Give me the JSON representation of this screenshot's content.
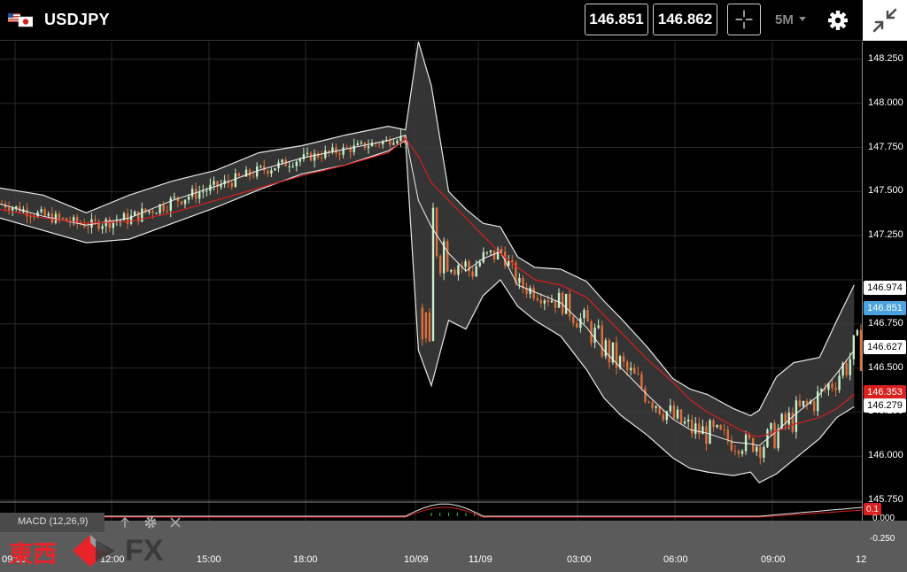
{
  "header": {
    "symbol": "USDJPY",
    "bid": "146.851",
    "ask": "146.862",
    "timeframe": "5M"
  },
  "price_axis": {
    "ticks": [
      "148.250",
      "148.000",
      "147.750",
      "147.500",
      "147.250",
      "146.750",
      "146.500",
      "146.250",
      "146.000",
      "145.750"
    ],
    "markers": {
      "upper_band": "146.974",
      "current": "146.851",
      "middle_band": "146.627",
      "ma": "146.353",
      "lower_band": "146.279"
    }
  },
  "time_axis": {
    "ticks": [
      "09:00",
      "12:00",
      "15:00",
      "18:00",
      "10/09",
      "11/09",
      "03:00",
      "06:00",
      "09:00",
      "12"
    ]
  },
  "macd": {
    "title": "MACD (12,26,9)",
    "current_value": "0.1",
    "ticks": [
      "0.000",
      "-0.250"
    ]
  },
  "logo": {
    "kanji": "東西",
    "suffix": "FX"
  },
  "colors": {
    "background": "#000000",
    "bull": "#c8f0c8",
    "bear": "#e0703a",
    "band_fill": "#3a3a3a",
    "ma": "#d8201f",
    "accent_blue": "#4aa3df"
  },
  "chart_data": {
    "type": "candlestick",
    "symbol": "USDJPY",
    "timeframe": "5M",
    "ylim": [
      145.75,
      148.35
    ],
    "bollinger": {
      "x_frac": [
        0.0,
        0.05,
        0.1,
        0.15,
        0.2,
        0.25,
        0.3,
        0.35,
        0.4,
        0.45,
        0.47,
        0.485,
        0.5,
        0.52,
        0.54,
        0.56,
        0.58,
        0.6,
        0.62,
        0.65,
        0.68,
        0.7,
        0.72,
        0.75,
        0.78,
        0.8,
        0.82,
        0.85,
        0.87,
        0.88,
        0.9,
        0.92,
        0.95,
        0.97,
        0.99
      ],
      "upper": [
        147.52,
        147.48,
        147.38,
        147.48,
        147.56,
        147.62,
        147.72,
        147.76,
        147.82,
        147.87,
        147.85,
        148.35,
        148.1,
        147.5,
        147.4,
        147.32,
        147.3,
        147.13,
        147.07,
        147.06,
        146.99,
        146.88,
        146.78,
        146.62,
        146.44,
        146.38,
        146.35,
        146.27,
        146.23,
        146.26,
        146.45,
        146.53,
        146.56,
        146.77,
        146.97
      ],
      "middle": [
        147.43,
        147.36,
        147.31,
        147.35,
        147.45,
        147.53,
        147.62,
        147.69,
        147.74,
        147.79,
        147.82,
        147.45,
        147.3,
        147.15,
        147.05,
        147.12,
        147.16,
        146.97,
        146.93,
        146.87,
        146.73,
        146.6,
        146.5,
        146.35,
        146.21,
        146.15,
        146.13,
        146.08,
        146.07,
        146.06,
        146.14,
        146.23,
        146.35,
        146.47,
        146.6
      ],
      "lower": [
        147.35,
        147.28,
        147.21,
        147.23,
        147.32,
        147.41,
        147.51,
        147.6,
        147.65,
        147.73,
        147.79,
        146.6,
        146.4,
        146.77,
        146.72,
        146.91,
        147.0,
        146.85,
        146.77,
        146.68,
        146.49,
        146.33,
        146.23,
        146.12,
        145.99,
        145.93,
        145.91,
        145.89,
        145.91,
        145.85,
        145.9,
        145.98,
        146.1,
        146.22,
        146.28
      ]
    },
    "ma_line": [
      147.4,
      147.35,
      147.32,
      147.33,
      147.38,
      147.45,
      147.52,
      147.59,
      147.65,
      147.72,
      147.8,
      147.7,
      147.55,
      147.45,
      147.35,
      147.25,
      147.15,
      147.07,
      147.0,
      146.97,
      146.9,
      146.8,
      146.7,
      146.55,
      146.42,
      146.32,
      146.25,
      146.17,
      146.12,
      146.11,
      146.14,
      146.18,
      146.22,
      146.27,
      146.35
    ]
  }
}
